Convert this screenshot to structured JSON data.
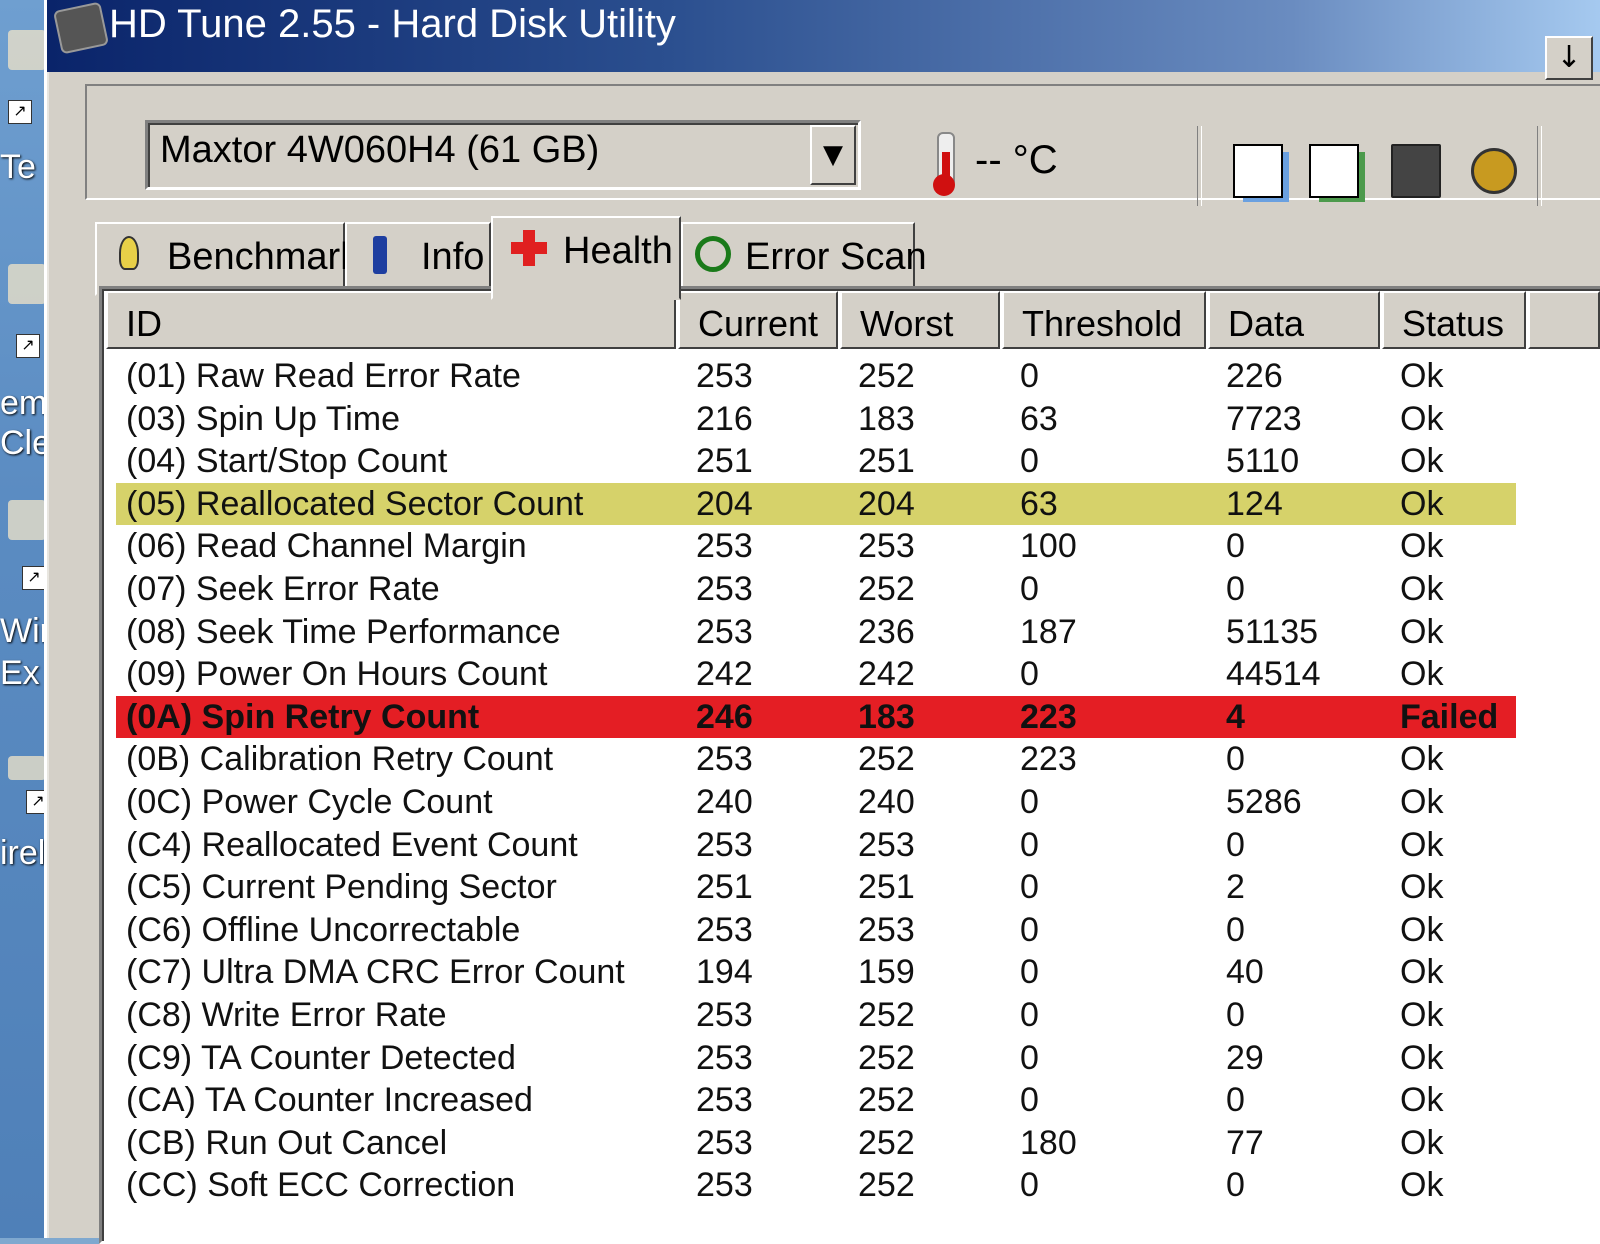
{
  "desktop": {
    "icon_labels": [
      "Te",
      "emp",
      "Cle",
      "Wir",
      "Ex",
      "irele"
    ]
  },
  "window": {
    "title": "HD Tune 2.55 - Hard Disk Utility",
    "title_button": "↓"
  },
  "toolbar": {
    "drive": "Maxtor 4W060H4 (61 GB)",
    "temperature": "-- °C",
    "icons": [
      "copy-text-icon",
      "copy-screenshot-icon",
      "disk-icon",
      "options-icon"
    ]
  },
  "tabs": [
    {
      "label": "Benchmark",
      "icon": "bulb-icon"
    },
    {
      "label": "Info",
      "icon": "info-icon"
    },
    {
      "label": "Health",
      "icon": "health-cross-icon",
      "active": true
    },
    {
      "label": "Error Scan",
      "icon": "magnifier-icon"
    }
  ],
  "table": {
    "columns": [
      "ID",
      "Current",
      "Worst",
      "Threshold",
      "Data",
      "Status"
    ],
    "rows": [
      {
        "id": "(01) Raw Read Error Rate",
        "current": "253",
        "worst": "252",
        "threshold": "0",
        "data": "226",
        "status": "Ok"
      },
      {
        "id": "(03) Spin Up Time",
        "current": "216",
        "worst": "183",
        "threshold": "63",
        "data": "7723",
        "status": "Ok"
      },
      {
        "id": "(04) Start/Stop Count",
        "current": "251",
        "worst": "251",
        "threshold": "0",
        "data": "5110",
        "status": "Ok"
      },
      {
        "id": "(05) Reallocated Sector Count",
        "current": "204",
        "worst": "204",
        "threshold": "63",
        "data": "124",
        "status": "Ok",
        "highlight": "warning"
      },
      {
        "id": "(06) Read Channel Margin",
        "current": "253",
        "worst": "253",
        "threshold": "100",
        "data": "0",
        "status": "Ok"
      },
      {
        "id": "(07) Seek Error Rate",
        "current": "253",
        "worst": "252",
        "threshold": "0",
        "data": "0",
        "status": "Ok"
      },
      {
        "id": "(08) Seek Time Performance",
        "current": "253",
        "worst": "236",
        "threshold": "187",
        "data": "51135",
        "status": "Ok"
      },
      {
        "id": "(09) Power On Hours Count",
        "current": "242",
        "worst": "242",
        "threshold": "0",
        "data": "44514",
        "status": "Ok"
      },
      {
        "id": "(0A) Spin Retry Count",
        "current": "246",
        "worst": "183",
        "threshold": "223",
        "data": "4",
        "status": "Failed",
        "highlight": "failed"
      },
      {
        "id": "(0B) Calibration Retry Count",
        "current": "253",
        "worst": "252",
        "threshold": "223",
        "data": "0",
        "status": "Ok"
      },
      {
        "id": "(0C) Power Cycle Count",
        "current": "240",
        "worst": "240",
        "threshold": "0",
        "data": "5286",
        "status": "Ok"
      },
      {
        "id": "(C4) Reallocated Event Count",
        "current": "253",
        "worst": "253",
        "threshold": "0",
        "data": "0",
        "status": "Ok"
      },
      {
        "id": "(C5) Current Pending Sector",
        "current": "251",
        "worst": "251",
        "threshold": "0",
        "data": "2",
        "status": "Ok"
      },
      {
        "id": "(C6) Offline Uncorrectable",
        "current": "253",
        "worst": "253",
        "threshold": "0",
        "data": "0",
        "status": "Ok"
      },
      {
        "id": "(C7) Ultra DMA CRC Error Count",
        "current": "194",
        "worst": "159",
        "threshold": "0",
        "data": "40",
        "status": "Ok"
      },
      {
        "id": "(C8) Write Error Rate",
        "current": "253",
        "worst": "252",
        "threshold": "0",
        "data": "0",
        "status": "Ok"
      },
      {
        "id": "(C9) TA Counter Detected",
        "current": "253",
        "worst": "252",
        "threshold": "0",
        "data": "29",
        "status": "Ok"
      },
      {
        "id": "(CA) TA Counter Increased",
        "current": "253",
        "worst": "252",
        "threshold": "0",
        "data": "0",
        "status": "Ok"
      },
      {
        "id": "(CB) Run Out Cancel",
        "current": "253",
        "worst": "252",
        "threshold": "180",
        "data": "77",
        "status": "Ok"
      },
      {
        "id": "(CC) Soft ECC Correction",
        "current": "253",
        "worst": "252",
        "threshold": "0",
        "data": "0",
        "status": "Ok"
      }
    ]
  },
  "colors": {
    "warning_row": "#d6d26a",
    "failed_row": "#e41e24",
    "title_bar": "#0a246a",
    "window_face": "#d4d0c8"
  }
}
